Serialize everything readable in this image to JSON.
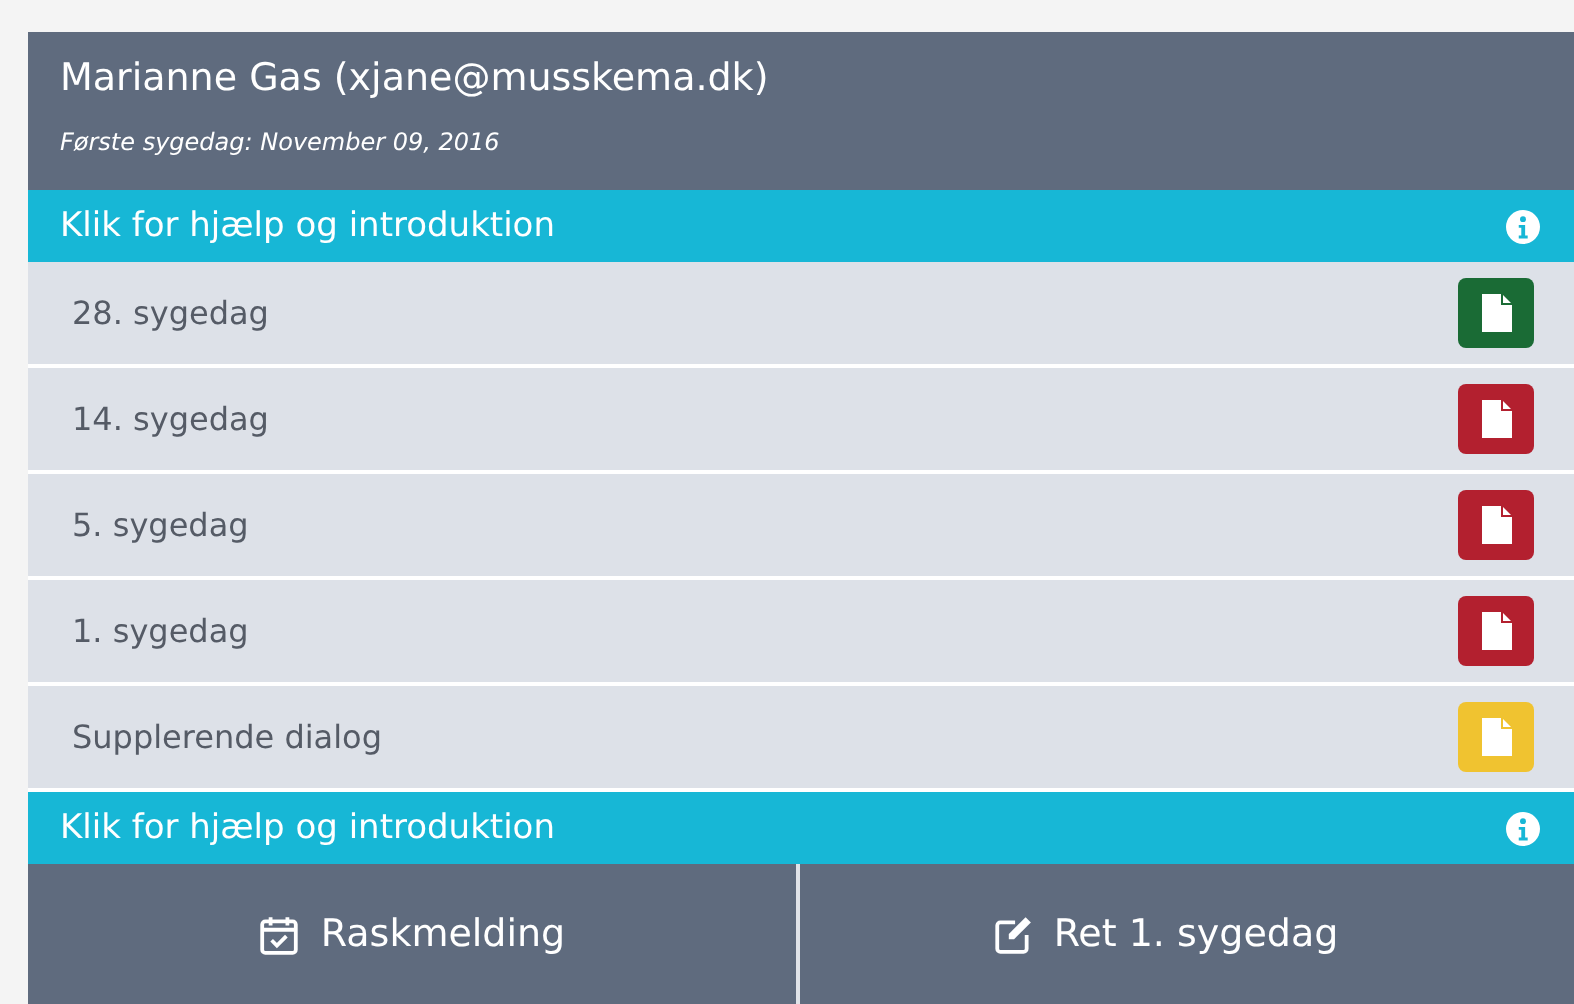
{
  "header": {
    "title": "Marianne Gas (xjane@musskema.dk)",
    "subtitle": "Første sygedag: November 09, 2016"
  },
  "help_bars": [
    {
      "label": "Klik for hjælp og introduktion"
    },
    {
      "label": "Klik for hjælp og introduktion"
    }
  ],
  "rows": [
    {
      "label": "28. sygedag",
      "color": "#1a6b35"
    },
    {
      "label": "14. sygedag",
      "color": "#b3202f"
    },
    {
      "label": "5. sygedag",
      "color": "#b3202f"
    },
    {
      "label": "1. sygedag",
      "color": "#b3202f"
    },
    {
      "label": "Supplerende dialog",
      "color": "#f0c330"
    }
  ],
  "buttons": [
    {
      "kind": "calendar",
      "label": "Raskmelding"
    },
    {
      "kind": "edit",
      "label": "Ret 1. sygedag"
    }
  ]
}
